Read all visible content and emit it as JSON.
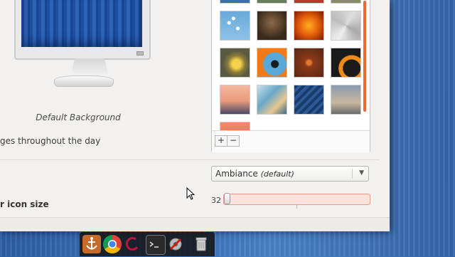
{
  "preview": {
    "caption": "Default Background",
    "changes_label": "ges throughout the day"
  },
  "wallpapers": {
    "icons": {
      "add": "+",
      "remove": "−"
    },
    "accent_scrollbar": "#e96b33"
  },
  "appearance": {
    "theme_name": "Ambiance",
    "theme_default": "(default)",
    "icon_size_label": "r icon size",
    "icon_size_value": "32",
    "icon_size_fraction": 0.0
  },
  "dock": {
    "items": [
      "anchor-icon",
      "chrome-icon",
      "debian-icon",
      "terminal-icon",
      "settings-icon",
      "trash-icon"
    ]
  }
}
